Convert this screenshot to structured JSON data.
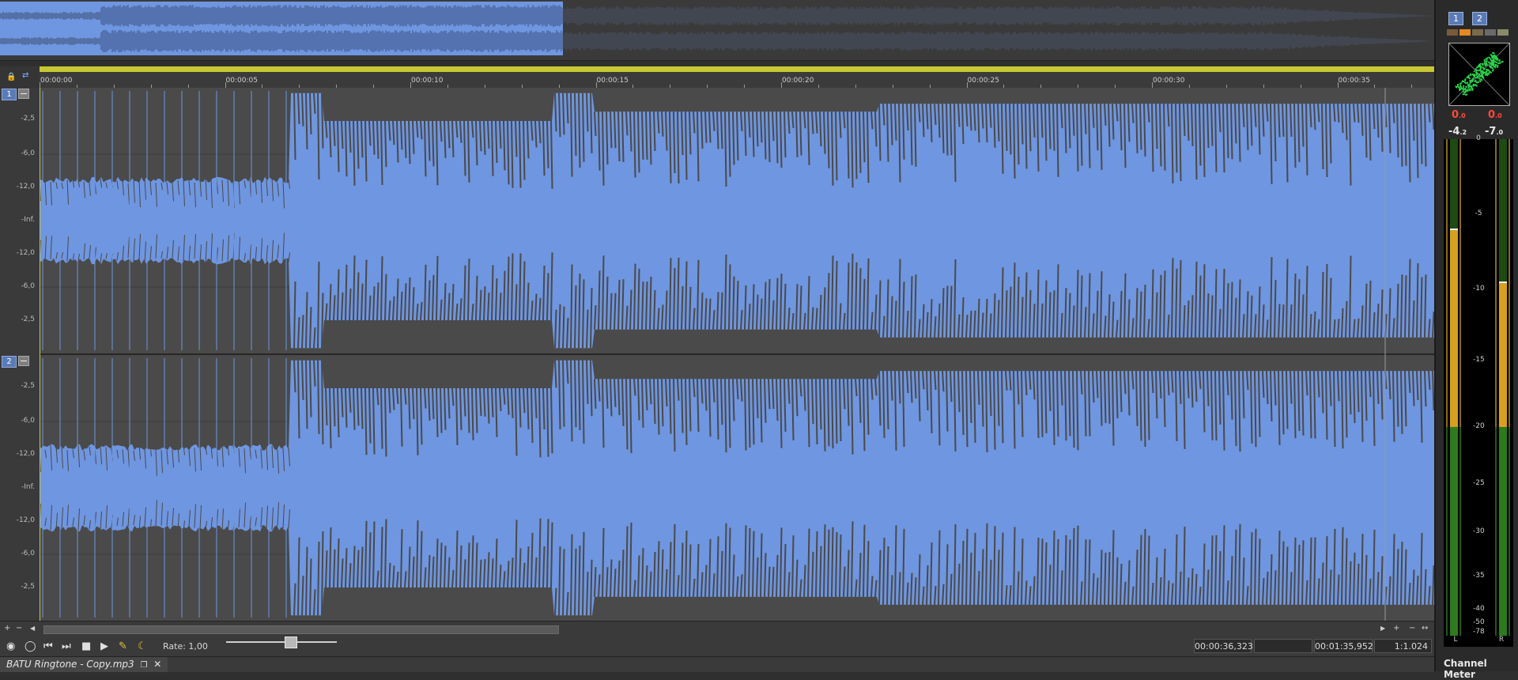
{
  "overview": {
    "label": "Waveform overview"
  },
  "ruler": {
    "ticks": [
      "00:00:00",
      "00:00:05",
      "00:00:10",
      "00:00:15",
      "00:00:20",
      "00:00:25",
      "00:00:30",
      "00:00:35"
    ]
  },
  "channels": [
    {
      "number": "1",
      "db_labels": [
        "-2,5",
        "-6,0",
        "-12,0",
        "-Inf.",
        "-12,0",
        "-6,0",
        "-2,5"
      ]
    },
    {
      "number": "2",
      "db_labels": [
        "-2,5",
        "-6,0",
        "-12,0",
        "-Inf.",
        "-12,0",
        "-6,0",
        "-2,5"
      ]
    }
  ],
  "transport": {
    "rate_label": "Rate: 1,00",
    "rate_value": 1.0,
    "cursor_time": "00:00:36,323",
    "selection_time": "",
    "length_time": "00:01:35,952",
    "zoom": "1:1.024"
  },
  "tab": {
    "title": "BATU Ringtone - Copy.mp3",
    "float_icon": "float-window-icon",
    "close_icon": "close-icon"
  },
  "right_panel": {
    "buttons": [
      "1",
      "2"
    ],
    "peak_left": "0",
    "peak_left_dec": ".0",
    "peak_right": "0",
    "peak_right_dec": ".0",
    "rms_left": "-4",
    "rms_left_dec": ".2",
    "rms_right": "-7",
    "rms_right_dec": ".0",
    "scale": [
      "0",
      "-5",
      "-10",
      "-15",
      "-20",
      "-25",
      "-30",
      "-35",
      "-40",
      "-50",
      "-78"
    ],
    "left_channel": "L",
    "right_channel": "R",
    "title": "Channel Meter"
  },
  "colors": {
    "waveform": "#6f96e0",
    "background": "#4a4a4a",
    "ruler_bar": "#c8c832",
    "meter_green": "#2e7a1e",
    "meter_yellow": "#d8a020"
  }
}
